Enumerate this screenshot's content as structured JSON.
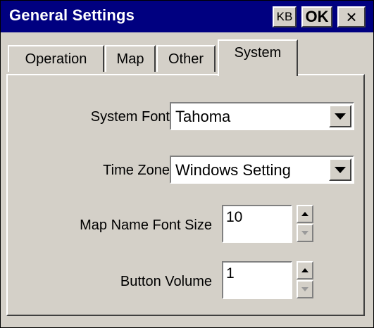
{
  "window": {
    "title": "General Settings",
    "buttons": {
      "kb": "KB",
      "ok": "OK",
      "close": "×"
    }
  },
  "tabs": [
    {
      "label": "Operation",
      "active": false
    },
    {
      "label": "Map",
      "active": false
    },
    {
      "label": "Other",
      "active": false
    },
    {
      "label": "System",
      "active": true
    }
  ],
  "settings": {
    "system_font": {
      "label": "System Font",
      "value": "Tahoma"
    },
    "time_zone": {
      "label": "Time Zone",
      "value": "Windows Setting"
    },
    "map_name_font_size": {
      "label": "Map Name Font Size",
      "value": "10"
    },
    "button_volume": {
      "label": "Button Volume",
      "value": "1"
    }
  },
  "colors": {
    "titlebar": "#000080",
    "face": "#d4d0c8"
  },
  "icons": {
    "close": "close-icon",
    "dropdown": "chevron-down-icon",
    "spin_up": "spin-up-icon",
    "spin_down": "spin-down-icon"
  }
}
